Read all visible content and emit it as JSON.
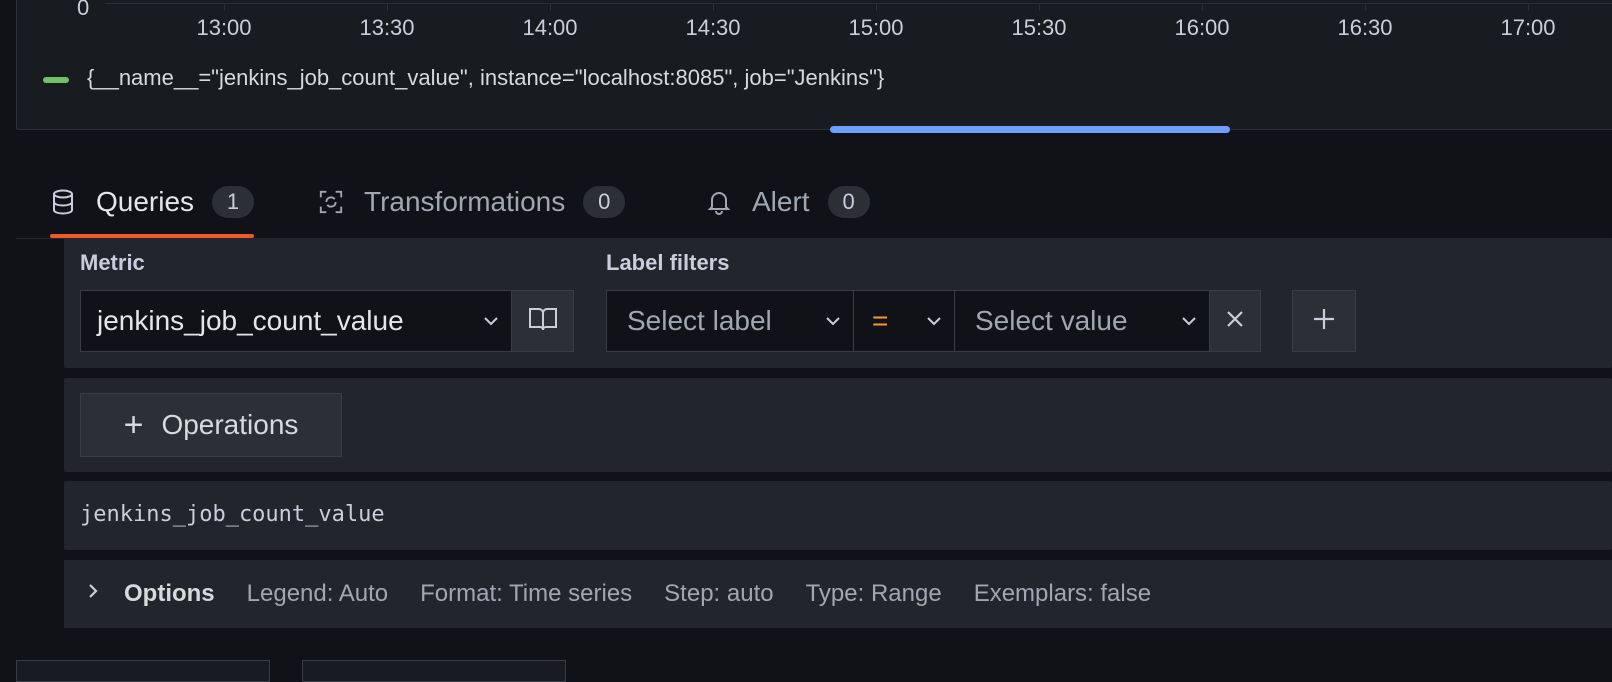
{
  "chart": {
    "y_zero_label": "0",
    "x_ticks": [
      "13:00",
      "13:30",
      "14:00",
      "14:30",
      "15:00",
      "15:30",
      "16:00",
      "16:30",
      "17:00"
    ],
    "legend": "{__name__=\"jenkins_job_count_value\", instance=\"localhost:8085\", job=\"Jenkins\"}",
    "series_color": "#73bf69"
  },
  "tabs": [
    {
      "label": "Queries",
      "count": "1",
      "icon": "database-icon",
      "active": true
    },
    {
      "label": "Transformations",
      "count": "0",
      "icon": "transform-icon",
      "active": false
    },
    {
      "label": "Alert",
      "count": "0",
      "icon": "bell-icon",
      "active": false
    }
  ],
  "builder": {
    "metric_label": "Metric",
    "metric_value": "jenkins_job_count_value",
    "label_filters_label": "Label filters",
    "select_label_placeholder": "Select label",
    "operator": "=",
    "select_value_placeholder": "Select value",
    "operations_button": "Operations",
    "raw_query": "jenkins_job_count_value"
  },
  "options": {
    "title": "Options",
    "items": [
      "Legend: Auto",
      "Format: Time series",
      "Step: auto",
      "Type: Range",
      "Exemplars: false"
    ]
  },
  "colors": {
    "active_tab_underline": "#f05a28",
    "splitter": "#6e9fff",
    "operator": "#ff9830"
  }
}
